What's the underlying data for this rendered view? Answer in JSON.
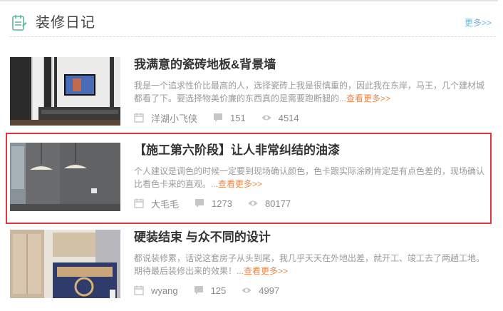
{
  "header": {
    "title": "装修日记",
    "more_label": "更多>>"
  },
  "diaries": [
    {
      "title": "我满意的瓷砖地板&背景墙",
      "summary": "我是一个追求性价比最高的人，选择瓷砖上我是很慎重的，因此我在东岸，马王，几个建材城都看了下。要选择物美价廉的东西真的是需要跑断腿的",
      "read_more": "...查看更多>>",
      "author": "洋湖小飞侠",
      "comments": "151",
      "views": "4514"
    },
    {
      "title": "【施工第六阶段】让人非常纠结的油漆",
      "summary": "个人建议是调色的时候一定要到现场确认颜色，色卡跟实际涂刷肯定是有点色差的，现场确认比看色卡来的直观。",
      "read_more": "...查看更多>>",
      "author": "大毛毛",
      "comments": "1273",
      "views": "80177"
    },
    {
      "title": "硬装结束 与众不同的设计",
      "summary": "都说装修累，话说这套房子从头到尾，我几乎天天在外地出差，就开工、竣工去了两趟工地。期待最后装修出来的效果！",
      "read_more": "...查看更多>>",
      "author": "wyang",
      "comments": "125",
      "views": "4997"
    }
  ],
  "colors": {
    "accent_more": "#6fb7d9",
    "read_more": "#e8884a",
    "highlight_border": "#e0373e"
  }
}
